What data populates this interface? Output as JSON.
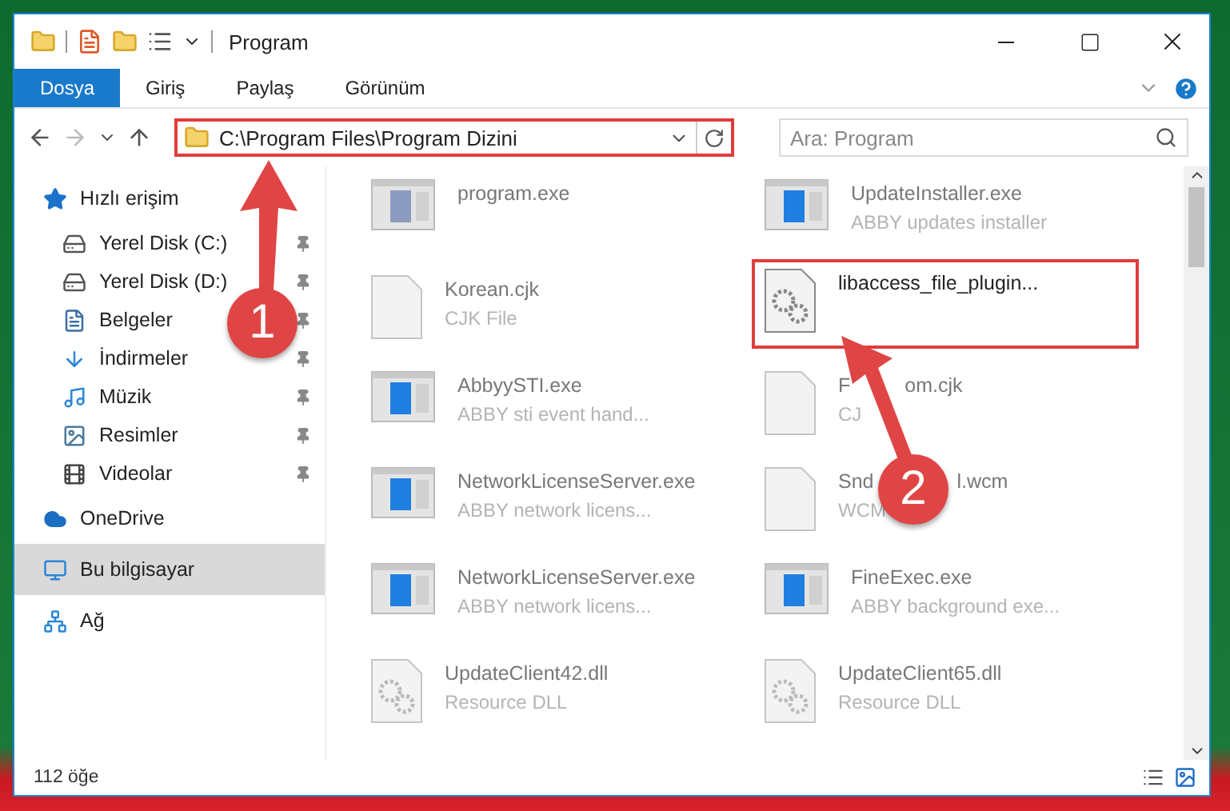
{
  "window": {
    "title": "Program"
  },
  "ribbon_tabs": [
    {
      "label": "Dosya",
      "selected": true
    },
    {
      "label": "Giriş",
      "selected": false
    },
    {
      "label": "Paylaş",
      "selected": false
    },
    {
      "label": "Görünüm",
      "selected": false
    }
  ],
  "address": {
    "path": "C:\\Program Files\\Program Dizini",
    "highlighted": true
  },
  "search": {
    "placeholder": "Ara: Program"
  },
  "navigation": [
    {
      "label": "Hızlı erişim",
      "kind": "star",
      "selected": false,
      "children": [
        {
          "label": "Yerel Disk (C:)",
          "kind": "system-drive",
          "pinned": true
        },
        {
          "label": "Yerel Disk (D:)",
          "kind": "drive",
          "pinned": true
        },
        {
          "label": "Belgeler",
          "kind": "document",
          "pinned": true
        },
        {
          "label": "İndirmeler",
          "kind": "download",
          "pinned": true
        },
        {
          "label": "Müzik",
          "kind": "music",
          "pinned": true
        },
        {
          "label": "Resimler",
          "kind": "image",
          "pinned": true
        },
        {
          "label": "Videolar",
          "kind": "video",
          "pinned": true
        }
      ]
    },
    {
      "label": "OneDrive",
      "kind": "cloud",
      "selected": false
    },
    {
      "label": "Bu bilgisayar",
      "kind": "computer",
      "selected": true
    },
    {
      "label": "Ağ",
      "kind": "network",
      "selected": false
    }
  ],
  "files": [
    {
      "name": "program.exe",
      "kind": "setup",
      "highlighted": false
    },
    {
      "name": "UpdateInstaller.exe",
      "type": "ABBY updates installer",
      "kind": "app",
      "highlighted": false
    },
    {
      "name": "Korean.cjk",
      "type": "CJK File",
      "kind": "blank",
      "highlighted": false
    },
    {
      "name": "libaccess_file_plugin...",
      "kind": "gear",
      "highlighted": true
    },
    {
      "name": "AbbyySTI.exe",
      "type": "ABBY sti event hand...",
      "kind": "app",
      "highlighted": false
    },
    {
      "name": "F",
      "name_tail": "om.cjk",
      "type": "CJ",
      "kind": "blank",
      "highlighted": false
    },
    {
      "name": "NetworkLicenseServer.exe",
      "type": "ABBY network licens...",
      "kind": "app",
      "highlighted": false
    },
    {
      "name": "Snd",
      "name_tail": "l.wcm",
      "type": "WCM",
      "kind": "blank",
      "highlighted": false
    },
    {
      "name": "NetworkLicenseServer.exe",
      "type": "ABBY network licens...",
      "kind": "app",
      "highlighted": false
    },
    {
      "name": "FineExec.exe",
      "type": "ABBY background exe...",
      "kind": "app",
      "highlighted": false
    },
    {
      "name": "UpdateClient42.dll",
      "type": "Resource DLL",
      "kind": "dll",
      "highlighted": false
    },
    {
      "name": "UpdateClient65.dll",
      "type": "Resource DLL",
      "kind": "dll",
      "highlighted": false
    }
  ],
  "status_bar": {
    "item_count": "112 öğe"
  },
  "callouts": [
    {
      "number": "1"
    },
    {
      "number": "2"
    }
  ]
}
